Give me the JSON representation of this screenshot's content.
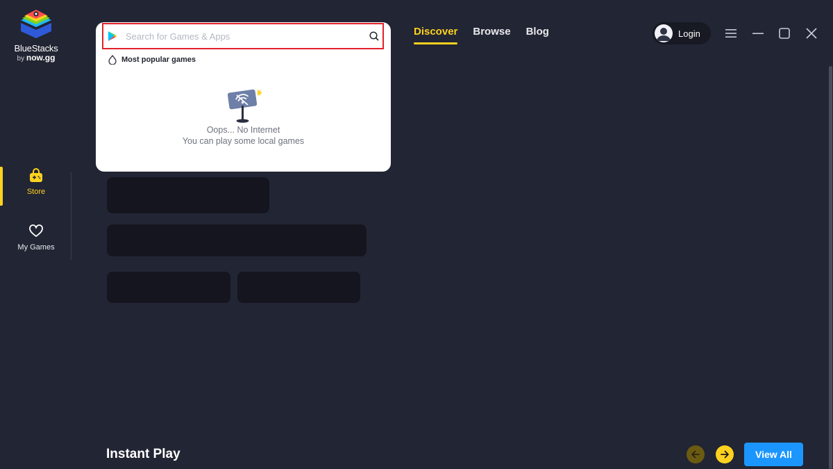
{
  "brand": {
    "name": "BlueStacks",
    "by_prefix": "by",
    "by_brand": "now.gg"
  },
  "sidebar": {
    "items": [
      {
        "label": "Store",
        "icon": "store-bag-icon",
        "active": true
      },
      {
        "label": "My Games",
        "icon": "heart-icon",
        "active": false
      }
    ]
  },
  "topnav": {
    "tabs": [
      {
        "label": "Discover",
        "active": true
      },
      {
        "label": "Browse",
        "active": false
      },
      {
        "label": "Blog",
        "active": false
      }
    ],
    "login_label": "Login"
  },
  "search": {
    "placeholder": "Search for Games & Apps",
    "value": "",
    "popular_label": "Most popular games",
    "empty_title": "Oops... No Internet",
    "empty_subtitle": "You can play some local games"
  },
  "instant_play": {
    "title": "Instant Play",
    "view_all_label": "View All"
  },
  "colors": {
    "background": "#222533",
    "accent": "#ffd21f",
    "primary_button": "#1b96ff",
    "search_highlight": "#e0202a",
    "skeleton": "#14151f"
  }
}
